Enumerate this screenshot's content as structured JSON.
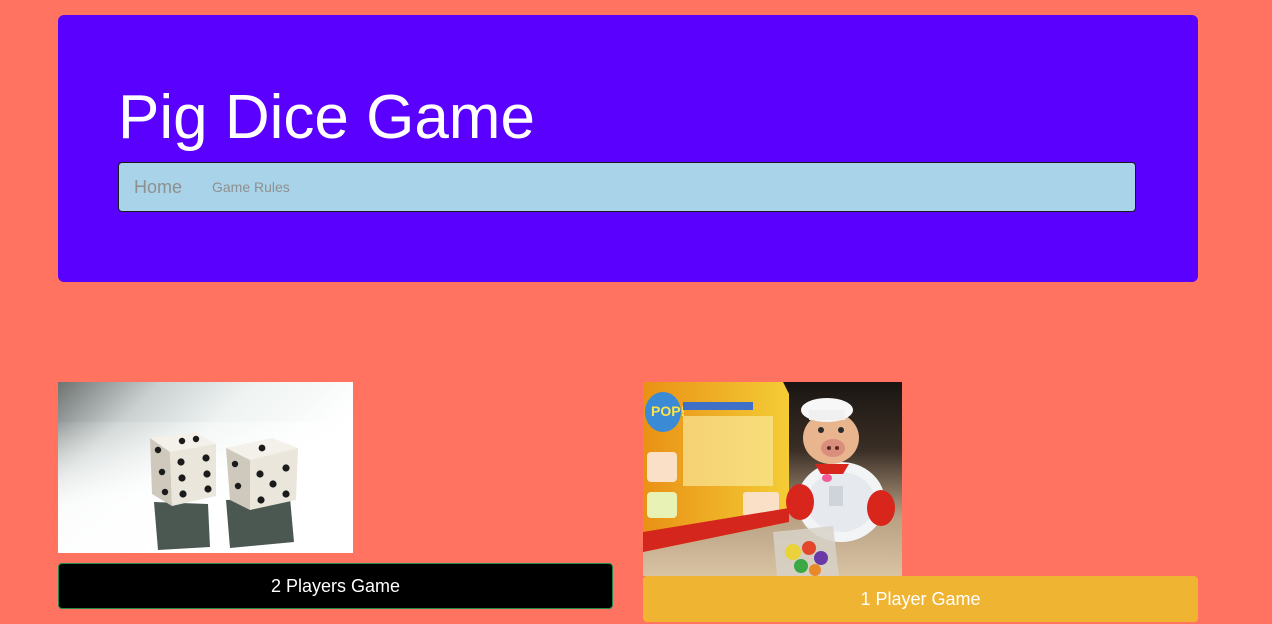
{
  "header": {
    "title": "Pig Dice Game"
  },
  "nav": {
    "brand": "Home",
    "links": [
      "Game Rules"
    ]
  },
  "games": {
    "two_player": {
      "button_label": "2 Players Game"
    },
    "one_player": {
      "button_label": "1 Player Game"
    }
  },
  "colors": {
    "page_background": "#ff7360",
    "header_background": "#5a00ff",
    "navbar_background": "#a8d3e8",
    "two_player_button": "#000000",
    "one_player_button": "#f0b433"
  }
}
